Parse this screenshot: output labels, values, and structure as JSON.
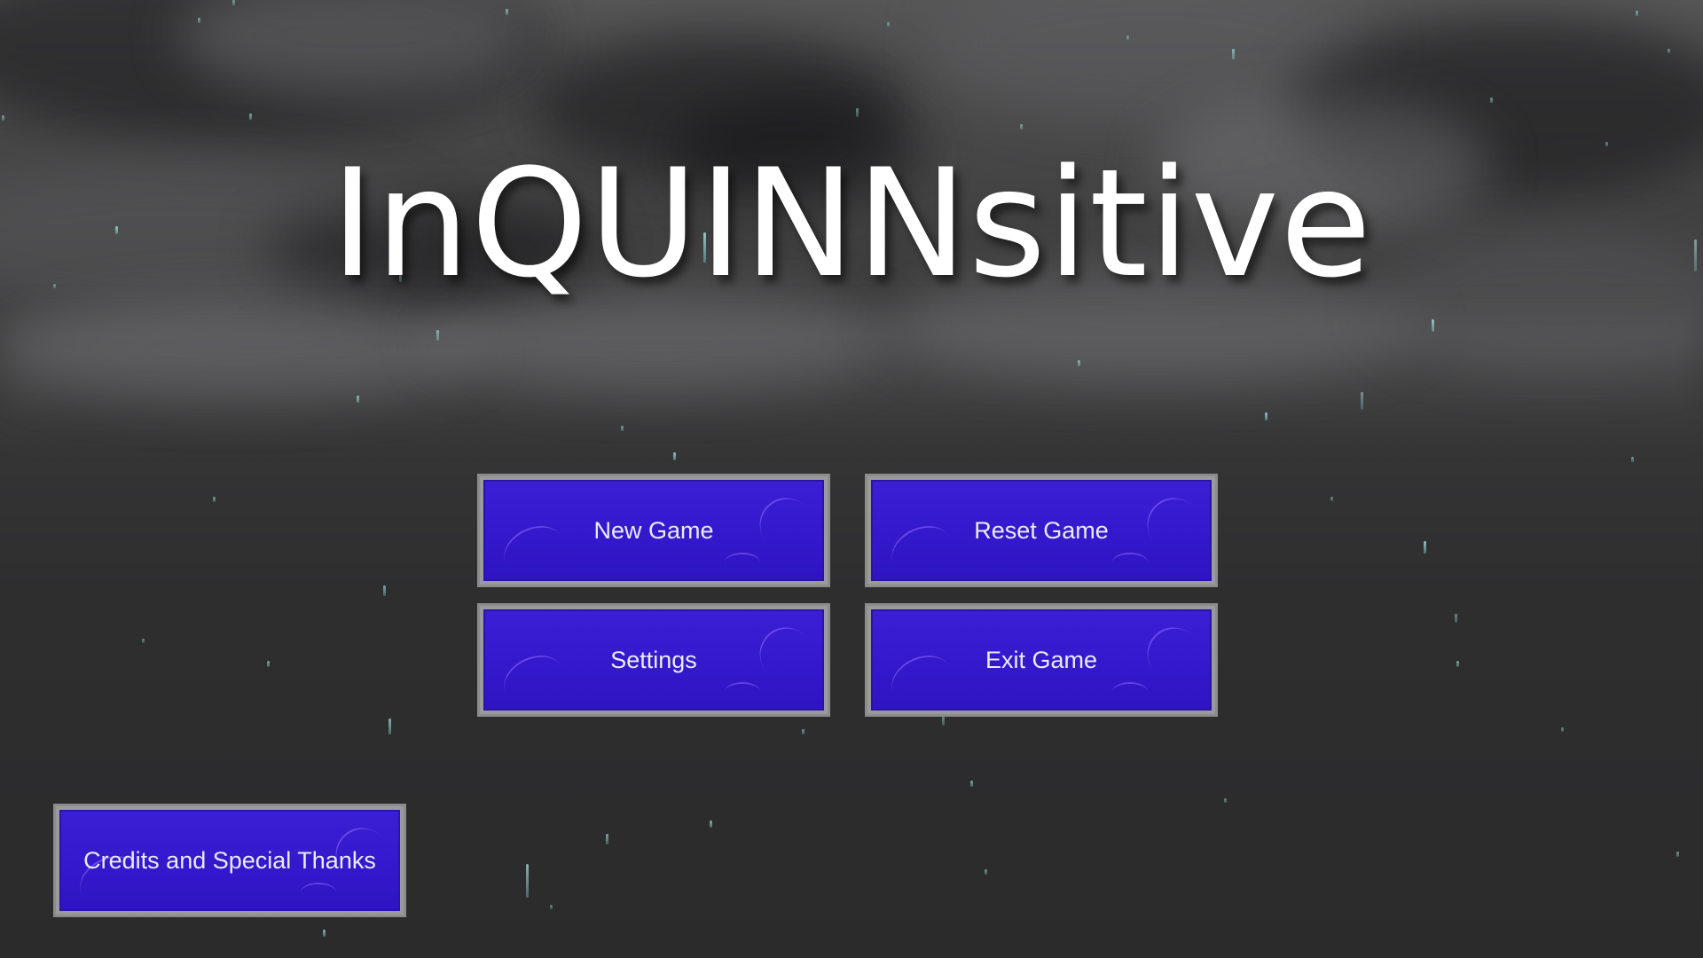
{
  "title": "InQUINNsitive",
  "menu": {
    "new_game": "New Game",
    "reset_game": "Reset Game",
    "settings": "Settings",
    "exit_game": "Exit Game",
    "credits": "Credits and Special Thanks"
  },
  "colors": {
    "button_fill": "#3418cc",
    "button_border": "#8c8c8c",
    "title_text": "#ffffff",
    "rain": "#aae6e6"
  },
  "background": "stormy-sky-rain"
}
